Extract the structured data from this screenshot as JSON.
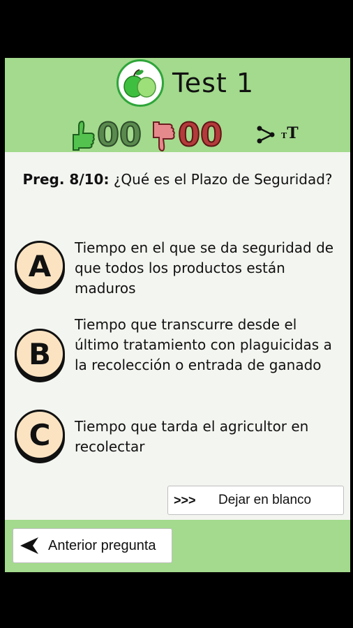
{
  "header": {
    "title": "Test 1",
    "logo_icon": "apple-logo-icon",
    "correct_count": "00",
    "wrong_count": "00",
    "share_icon": "share-icon",
    "text_size_icon": "text-size-icon",
    "text_size_small": "T",
    "text_size_big": "T"
  },
  "question": {
    "number": "Preg. 8/10:",
    "text": "¿Qué es el Plazo de Seguridad?"
  },
  "answers": [
    {
      "letter": "A",
      "text": "Tiempo en el que se da seguridad de que todos los productos están maduros"
    },
    {
      "letter": "B",
      "text": "Tiempo que transcurre desde el último tratamiento con plaguicidas a la recolección o entrada de ganado"
    },
    {
      "letter": "C",
      "text": "Tiempo que tarda el agricultor en recolectar"
    }
  ],
  "skip": {
    "arrows": ">>>",
    "label": "Dejar en blanco"
  },
  "footer": {
    "prev_label": "Anterior pregunta"
  },
  "colors": {
    "header_green": "#a3da8d",
    "answer_badge": "#fbe3c1",
    "correct": "#5b8a4e",
    "wrong": "#b33b3b"
  }
}
